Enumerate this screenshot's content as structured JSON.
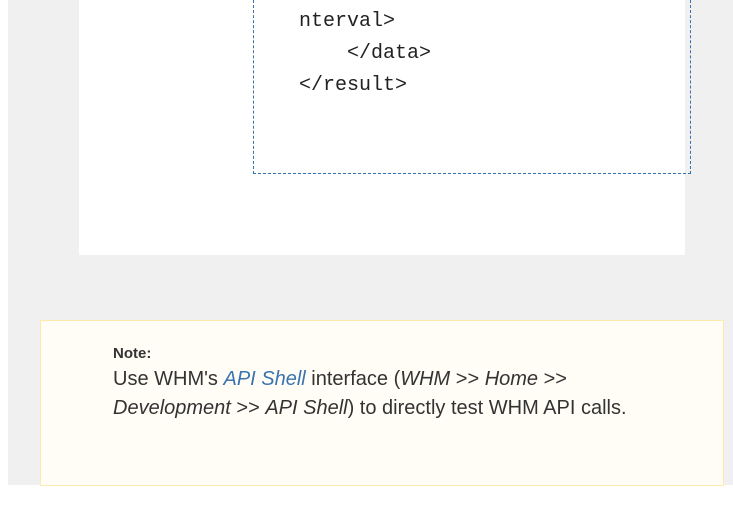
{
  "code_block": {
    "lines": [
      "nterval>",
      "    </data>",
      "</result>"
    ]
  },
  "note": {
    "title": "Note:",
    "text_1": "Use WHM's ",
    "link_label": "API Shell",
    "text_2": " interface (",
    "path_1": "WHM",
    "sep_1": " >> ",
    "path_2": "Home",
    "sep_2": " >> ",
    "path_3": "Development",
    "sep_3": " >> ",
    "path_4": "API Shell",
    "text_3": ") to directly test WHM API calls."
  },
  "colors": {
    "panel_bg": "#f0f0f0",
    "note_bg": "#fffdf6",
    "note_border": "#ffeaae",
    "link": "#3b73af",
    "dashed_border": "#3572b0"
  }
}
